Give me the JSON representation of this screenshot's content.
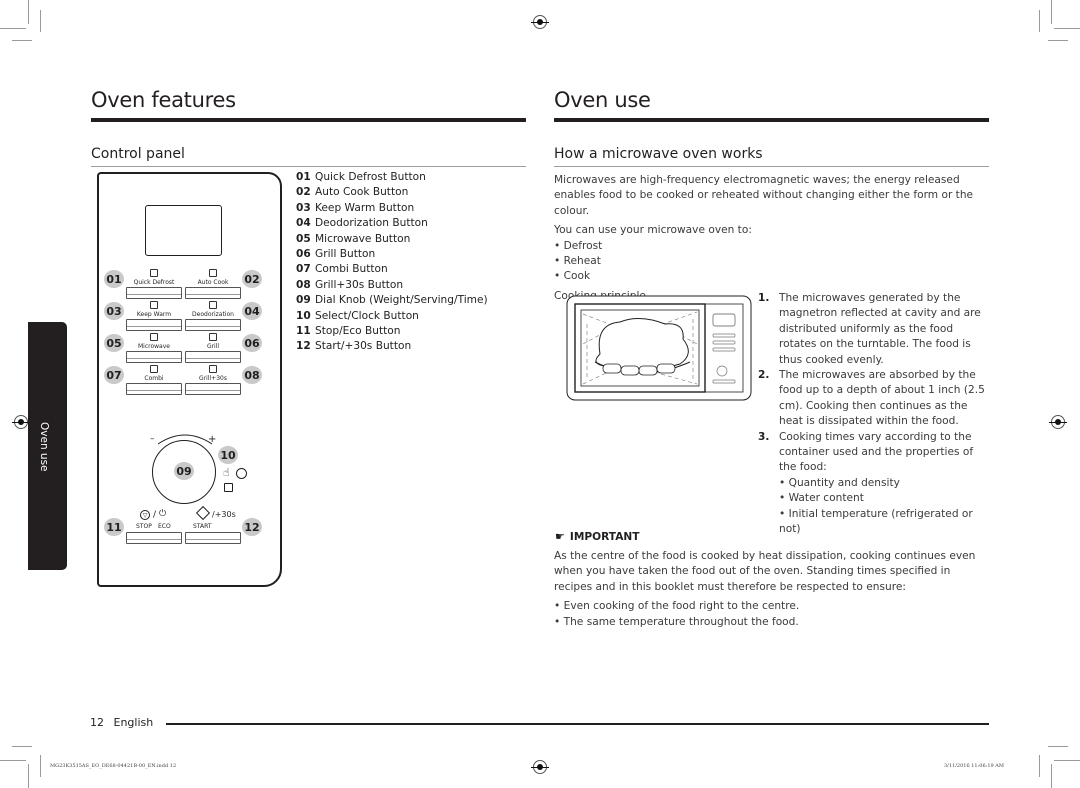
{
  "left_page": {
    "title": "Oven features",
    "section": "Control panel",
    "panel_buttons": [
      {
        "num": "01",
        "label": "Quick Defrost"
      },
      {
        "num": "02",
        "label": "Auto Cook"
      },
      {
        "num": "03",
        "label": "Keep Warm"
      },
      {
        "num": "04",
        "label": "Deodorization"
      },
      {
        "num": "05",
        "label": "Microwave"
      },
      {
        "num": "06",
        "label": "Grill"
      },
      {
        "num": "07",
        "label": "Combi"
      },
      {
        "num": "08",
        "label": "Grill+30s"
      }
    ],
    "dial": {
      "num": "09",
      "minus": "–",
      "plus": "+"
    },
    "select_num": "10",
    "stop": {
      "num": "11",
      "stop_label": "STOP",
      "eco_label": "ECO",
      "slash": "/"
    },
    "start": {
      "num": "12",
      "start_label": "START",
      "plus_label": "/+30s"
    },
    "legend": [
      {
        "num": "01",
        "text": "Quick Defrost Button"
      },
      {
        "num": "02",
        "text": "Auto Cook Button"
      },
      {
        "num": "03",
        "text": "Keep Warm Button"
      },
      {
        "num": "04",
        "text": "Deodorization Button"
      },
      {
        "num": "05",
        "text": "Microwave Button"
      },
      {
        "num": "06",
        "text": "Grill Button"
      },
      {
        "num": "07",
        "text": "Combi Button"
      },
      {
        "num": "08",
        "text": "Grill+30s Button"
      },
      {
        "num": "09",
        "text": "Dial Knob (Weight/Serving/Time)"
      },
      {
        "num": "10",
        "text": "Select/Clock Button"
      },
      {
        "num": "11",
        "text": "Stop/Eco Button"
      },
      {
        "num": "12",
        "text": "Start/+30s Button"
      }
    ]
  },
  "side_tab": "Oven use",
  "right_page": {
    "title": "Oven use",
    "section": "How a microwave oven works",
    "intro": "Microwaves are high-frequency electromagnetic waves; the energy released enables food to be cooked or reheated without changing either the form or the colour.",
    "can_use": "You can use your microwave oven to:",
    "uses": [
      "Defrost",
      "Reheat",
      "Cook"
    ],
    "principle_label": "Cooking principle.",
    "steps": [
      {
        "n": "1.",
        "text": "The microwaves generated by the magnetron reflected at cavity and are distributed uniformly as the food rotates on the turntable. The food is thus cooked evenly."
      },
      {
        "n": "2.",
        "text": "The microwaves are absorbed by the food up to a depth of about 1 inch (2.5 cm). Cooking then continues as the heat is dissipated within the food."
      },
      {
        "n": "3.",
        "text": "Cooking times vary according to the container used and the properties of the food:"
      }
    ],
    "step3_bullets": [
      "Quantity and density",
      "Water content",
      "Initial temperature (refrigerated or not)"
    ],
    "important_label": "IMPORTANT",
    "important_text": "As the centre of the food is cooked by heat dissipation, cooking continues even when you have taken the food out of the oven. Standing times specified in recipes and in this booklet must therefore be respected to ensure:",
    "important_bullets": [
      "Even cooking of the food right to the centre.",
      "The same temperature throughout the food."
    ]
  },
  "footer": {
    "page_num": "12",
    "language": "English",
    "slug_file": "MG23K3515AS_EO_DE68-04421B-00_EN.indd   12",
    "slug_date": "3/11/2016   11:06:19 AM"
  }
}
